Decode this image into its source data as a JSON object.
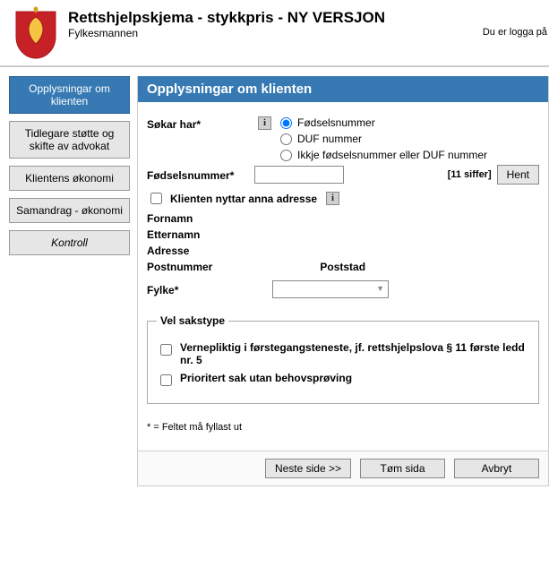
{
  "header": {
    "title": "Rettshjelpskjema - stykkpris - NY VERSJON",
    "subtitle": "Fylkesmannen",
    "logged_in": "Du er logga på"
  },
  "sidebar": {
    "items": [
      {
        "label": "Opplysningar om klienten",
        "active": true
      },
      {
        "label": "Tidlegare støtte og skifte av advokat"
      },
      {
        "label": "Klientens økonomi"
      },
      {
        "label": "Samandrag - økonomi"
      },
      {
        "label": "Kontroll",
        "style": "kontroll"
      }
    ]
  },
  "section": {
    "title": "Opplysningar om klienten"
  },
  "form": {
    "seeker_label": "Søkar har",
    "id_options": {
      "fn": "Fødselsnummer",
      "duf": "DUF nummer",
      "none": "Ikkje fødselsnummer eller DUF nummer"
    },
    "fn_label": "Fødselsnummer",
    "fn_hint": "[11 siffer]",
    "fetch_button": "Hent",
    "alt_addr": "Klienten nyttar anna adresse",
    "first_name": "Fornamn",
    "last_name": "Etternamn",
    "address": "Adresse",
    "postnr": "Postnummer",
    "poststad": "Poststad",
    "fylke": "Fylke",
    "fylke_value": ""
  },
  "case_type": {
    "legend": "Vel sakstype",
    "opt1": "Vernepliktig i førstegangsteneste, jf. rettshjelpslova § 11 første ledd nr. 5",
    "opt2": "Prioritert sak utan behovsprøving"
  },
  "footnote": "* = Feltet må fyllast ut",
  "buttons": {
    "next": "Neste side >>",
    "clear": "Tøm sida",
    "cancel": "Avbryt"
  }
}
